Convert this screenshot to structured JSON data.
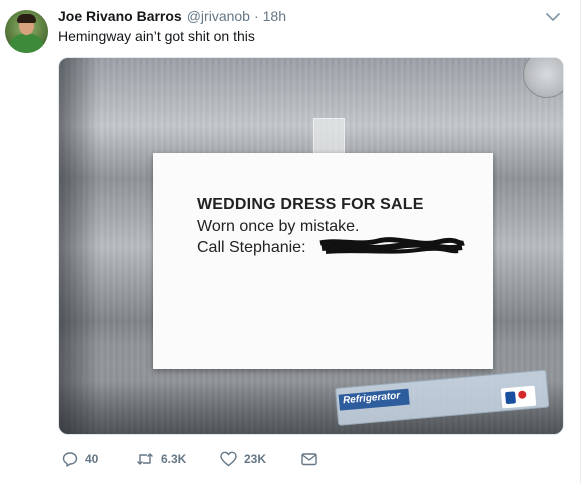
{
  "tweet": {
    "author_name": "Joe Rivano Barros",
    "author_handle": "@jrivanob",
    "separator": "·",
    "time": "18h",
    "text": "Hemingway ain’t got shit on this",
    "menu_icon": "chevron-down-icon"
  },
  "media": {
    "note": {
      "line1": "WEDDING DRESS FOR SALE",
      "line2": "Worn once by mistake.",
      "line3": "Call Stephanie:"
    },
    "fridge_label": "Refrigerator"
  },
  "actions": {
    "reply": {
      "icon": "reply-icon",
      "count": "40"
    },
    "retweet": {
      "icon": "retweet-icon",
      "count": "6.3K"
    },
    "like": {
      "icon": "heart-icon",
      "count": "23K"
    },
    "dm": {
      "icon": "envelope-icon"
    }
  },
  "colors": {
    "text": "#14171a",
    "muted": "#657786",
    "border": "#e6ecf0"
  }
}
